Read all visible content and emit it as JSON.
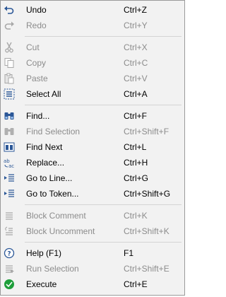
{
  "menu": {
    "items": [
      {
        "label": "Undo",
        "shortcut": "Ctrl+Z",
        "enabled": true,
        "icon": "undo-icon"
      },
      {
        "label": "Redo",
        "shortcut": "Ctrl+Y",
        "enabled": false,
        "icon": "redo-icon"
      },
      {
        "label": "Cut",
        "shortcut": "Ctrl+X",
        "enabled": false,
        "icon": "cut-icon"
      },
      {
        "label": "Copy",
        "shortcut": "Ctrl+C",
        "enabled": false,
        "icon": "copy-icon"
      },
      {
        "label": "Paste",
        "shortcut": "Ctrl+V",
        "enabled": false,
        "icon": "paste-icon"
      },
      {
        "label": "Select All",
        "shortcut": "Ctrl+A",
        "enabled": true,
        "icon": "select-all-icon"
      },
      {
        "label": "Find...",
        "shortcut": "Ctrl+F",
        "enabled": true,
        "icon": "binoculars-icon"
      },
      {
        "label": "Find Selection",
        "shortcut": "Ctrl+Shift+F",
        "enabled": false,
        "icon": "find-selection-icon"
      },
      {
        "label": "Find Next",
        "shortcut": "Ctrl+L",
        "enabled": true,
        "icon": "find-next-icon"
      },
      {
        "label": "Replace...",
        "shortcut": "Ctrl+H",
        "enabled": true,
        "icon": "replace-icon"
      },
      {
        "label": "Go to Line...",
        "shortcut": "Ctrl+G",
        "enabled": true,
        "icon": "go-to-line-icon"
      },
      {
        "label": "Go to Token...",
        "shortcut": "Ctrl+Shift+G",
        "enabled": true,
        "icon": "go-to-token-icon"
      },
      {
        "label": "Block Comment",
        "shortcut": "Ctrl+K",
        "enabled": false,
        "icon": "block-comment-icon"
      },
      {
        "label": "Block Uncomment",
        "shortcut": "Ctrl+Shift+K",
        "enabled": false,
        "icon": "block-uncomment-icon"
      },
      {
        "label": "Help (F1)",
        "shortcut": "F1",
        "enabled": true,
        "icon": "help-icon"
      },
      {
        "label": "Run Selection",
        "shortcut": "Ctrl+Shift+E",
        "enabled": false,
        "icon": "run-selection-icon"
      },
      {
        "label": "Execute",
        "shortcut": "Ctrl+E",
        "enabled": true,
        "icon": "execute-icon"
      }
    ]
  },
  "colors": {
    "accent_blue": "#2b5797",
    "disabled_text": "#8c8c8c",
    "execute_green": "#1e9e3a"
  }
}
